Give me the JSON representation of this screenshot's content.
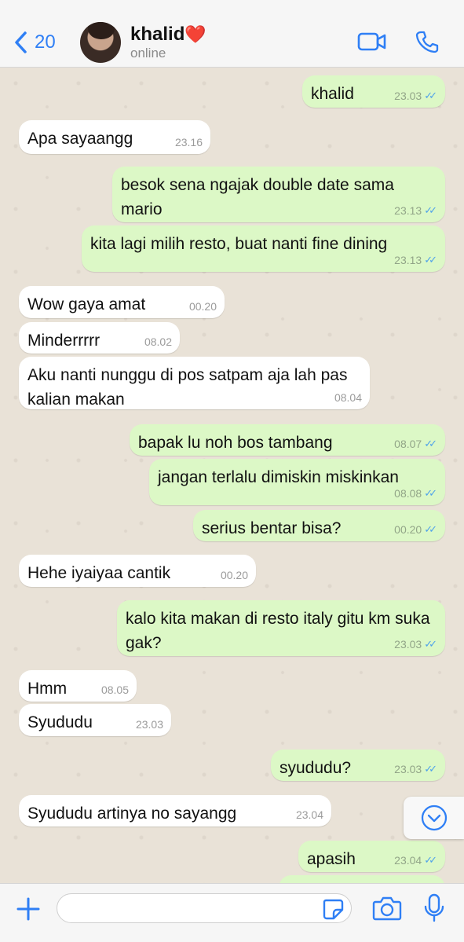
{
  "header": {
    "back_count": "20",
    "contact_name": "khalid",
    "name_emoji": "❤️",
    "status": "online",
    "accent_color": "#2f7ff5"
  },
  "messages": [
    {
      "dir": "out",
      "text": "khalid",
      "time": "23.03"
    },
    {
      "dir": "in",
      "text": "Apa sayaangg",
      "time": "23.16"
    },
    {
      "dir": "out",
      "text": "besok sena ngajak double date sama mario",
      "time": "23.13"
    },
    {
      "dir": "out",
      "text": "kita lagi milih resto, buat nanti fine dining",
      "time": "23.13"
    },
    {
      "dir": "in",
      "text": "Wow gaya amat",
      "time": "00.20"
    },
    {
      "dir": "in",
      "text": "Minderrrrr",
      "time": "08.02"
    },
    {
      "dir": "in",
      "text": "Aku nanti nunggu di pos satpam aja lah pas kalian makan",
      "time": "08.04"
    },
    {
      "dir": "out",
      "text": "bapak lu noh bos tambang",
      "time": "08.07"
    },
    {
      "dir": "out",
      "text": "jangan terlalu dimiskin miskinkan",
      "time": "08.08"
    },
    {
      "dir": "out",
      "text": "serius bentar bisa?",
      "time": "00.20"
    },
    {
      "dir": "in",
      "text": "Hehe iyaiyaa cantik",
      "time": "00.20"
    },
    {
      "dir": "out",
      "text": "kalo kita makan di resto italy gitu km suka gak?",
      "time": "23.03"
    },
    {
      "dir": "in",
      "text": "Hmm",
      "time": "08.05"
    },
    {
      "dir": "in",
      "text": "Syududu",
      "time": "23.03"
    },
    {
      "dir": "out",
      "text": "syududu?",
      "time": "23.03"
    },
    {
      "dir": "in",
      "text": "Syududu artinya no sayangg",
      "time": "23.04"
    },
    {
      "dir": "out",
      "text": "apasih",
      "time": "23.04"
    }
  ],
  "read_receipt": "✓✓",
  "icons": {
    "back": "chevron-left-icon",
    "video": "video-camera-icon",
    "call": "phone-icon",
    "scroll": "chevron-down-circle-icon",
    "attach": "plus-icon",
    "sticker": "sticker-icon",
    "camera": "camera-icon",
    "mic": "microphone-icon"
  },
  "composer": {
    "placeholder": ""
  }
}
